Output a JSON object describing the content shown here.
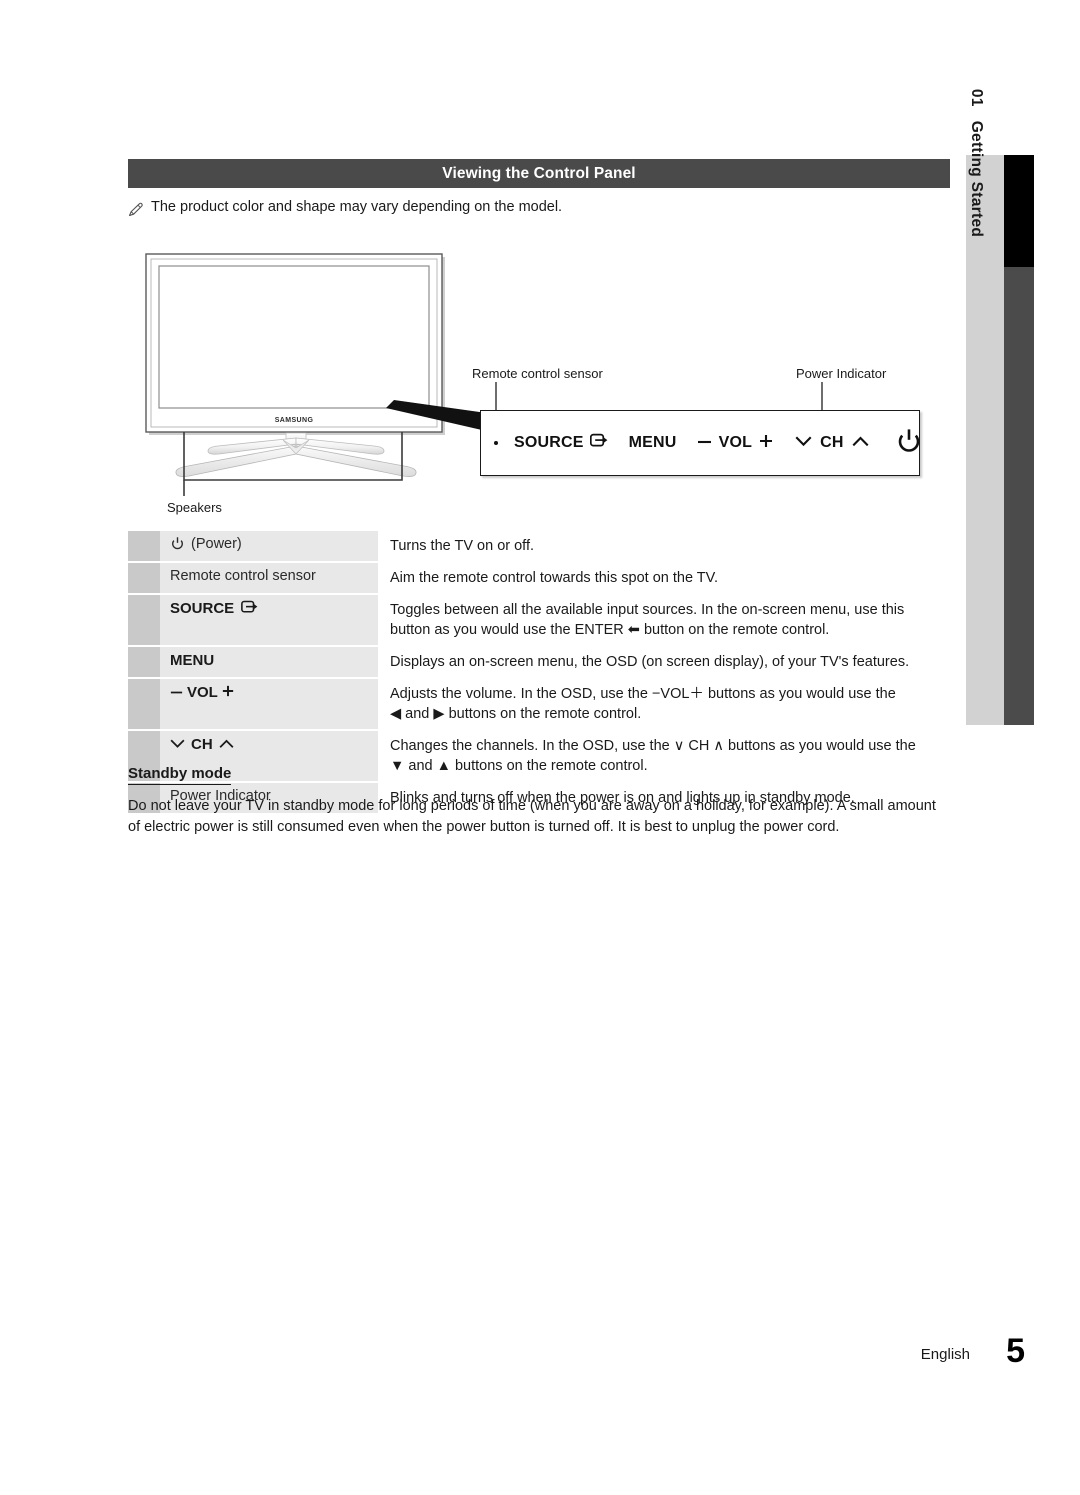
{
  "chapter_tab": {
    "number": "01",
    "title": "Getting Started"
  },
  "section": {
    "header": "Viewing the Control Panel",
    "note": "The product color and shape may vary depending on the model.",
    "note_icon": "pencil-note-icon"
  },
  "diagram": {
    "brand_logo": "SAMSUNG",
    "callouts": {
      "remote_sensor": "Remote control sensor",
      "power_indicator": "Power Indicator",
      "speakers": "Speakers"
    },
    "control_panel_items": [
      {
        "label": "SOURCE",
        "icon": "enter-source-icon"
      },
      {
        "label": "MENU",
        "icon": ""
      },
      {
        "label": "VOL",
        "icon": "minus-plus-icon"
      },
      {
        "label": "CH",
        "icon": "chevron-down-up-icon"
      },
      {
        "label": "",
        "icon": "power-icon"
      }
    ]
  },
  "spec_table": {
    "rows": [
      {
        "label": "(Power)",
        "label_icon": "power-icon",
        "bold": false,
        "desc_lines": [
          "Turns the TV on or off."
        ]
      },
      {
        "label": "Remote control sensor",
        "label_icon": "",
        "bold": false,
        "desc_lines": [
          "Aim the remote control towards this spot on the TV."
        ]
      },
      {
        "label": "SOURCE",
        "label_icon": "enter-source-icon",
        "bold": true,
        "desc_lines": [
          "Toggles between all the available input sources. In the on-screen menu, use this",
          "button as you would use the ENTER ⬅ button on the remote control."
        ]
      },
      {
        "label": "MENU",
        "label_icon": "",
        "bold": true,
        "desc_lines": [
          "Displays an on-screen menu, the OSD (on screen display), of your TV's features."
        ]
      },
      {
        "label": "VOL",
        "label_icon": "minus-plus-icon",
        "bold": true,
        "desc_lines": [
          "Adjusts the volume. In the OSD, use the −VOL＋ buttons as you would use the",
          "◀ and ▶ buttons on the remote control."
        ]
      },
      {
        "label": "CH",
        "label_icon": "chevron-down-up-icon",
        "bold": true,
        "desc_lines": [
          "Changes the channels. In the OSD, use the ∨ CH ∧ buttons as you would use the",
          "▼ and ▲ buttons on the remote control."
        ]
      },
      {
        "label": "Power Indicator",
        "label_icon": "",
        "bold": false,
        "desc_lines": [
          "Blinks and turns off when the power is on and lights up in standby mode."
        ]
      }
    ]
  },
  "standby": {
    "heading": "Standby mode",
    "body_lines": [
      "Do not leave your TV in standby mode for long periods of time (when you are away on a holiday, for example). A small amount",
      "of electric power is still consumed even when the power button is turned off. It is best to unplug the power cord."
    ]
  },
  "footer": {
    "language": "English",
    "page_number": "5"
  },
  "colors": {
    "header_bar": "#4a4a4a",
    "tab_light": "#d2d2d2",
    "tab_black": "#000000",
    "tab_gray": "#4b4b4b",
    "row_swatch": "#c9c9c9",
    "row_label_bg": "#e8e8e8"
  }
}
